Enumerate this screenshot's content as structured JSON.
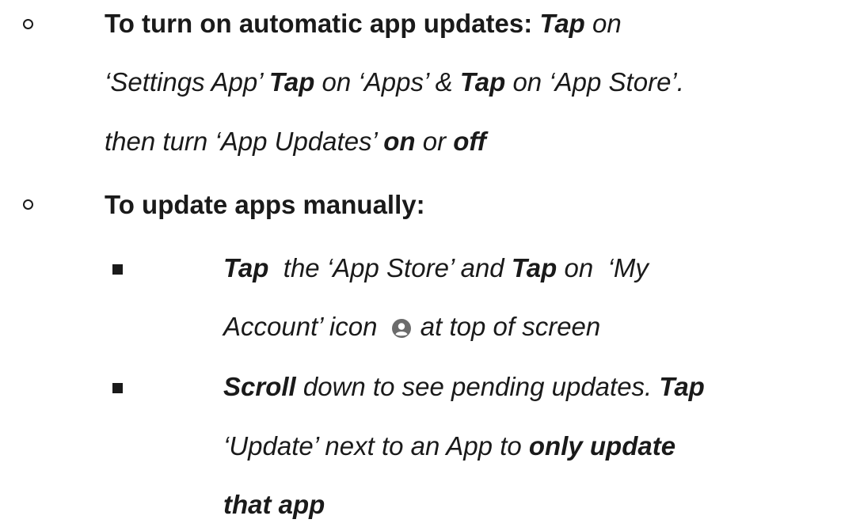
{
  "section1": {
    "heading": "To turn on automatic app updates:",
    "tap1": "Tap",
    "on1": " on",
    "settings": "‘Settings App’ ",
    "tap2": "Tap",
    "apps": " on ‘Apps’ & ",
    "tap3": "Tap",
    "appstore": " on ‘App Store’.",
    "then": "then turn ‘App Updates’ ",
    "on_word": "on",
    "or": " or ",
    "off_word": "off"
  },
  "section2": {
    "heading": "To update apps manually:",
    "item1": {
      "tap_a": "Tap",
      "text_a": "  the ‘App Store’ and ",
      "tap_b": "Tap",
      "text_b": " on  ‘My",
      "text_c": "Account’ icon ",
      "icon": "account-circle-icon",
      "text_d": " at top of screen"
    },
    "item2": {
      "scroll": "Scroll",
      "text_a": " down to see pending updates. ",
      "tap": "Tap",
      "text_b": "‘Update’ next to an App to ",
      "only": "only update",
      "that": "that app"
    }
  }
}
